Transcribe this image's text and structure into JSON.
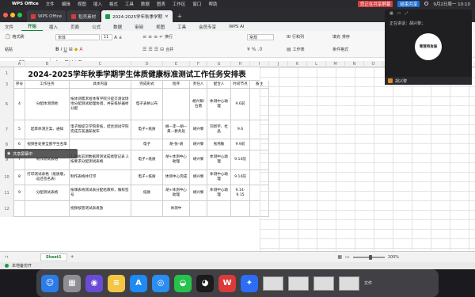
{
  "menubar": {
    "app": "WPS Office",
    "items": [
      "文件",
      "编辑",
      "视图",
      "插入",
      "格式",
      "工具",
      "数据",
      "图表",
      "工作区",
      "窗口",
      "帮助"
    ],
    "meeting_label": "您正在共享屏幕",
    "end_label": "结束共享",
    "datetime": "9月2日周一 10:10"
  },
  "tabs": [
    {
      "label": "WPS Office",
      "color": "#d93a3a"
    },
    {
      "label": "稻壳素材",
      "color": "#d93a3a"
    },
    {
      "label": "2024-2025学年秋季学期",
      "color": "#1a9e4a"
    }
  ],
  "ribbon_tabs": [
    "开始",
    "插入",
    "页面",
    "公式",
    "数据",
    "审阅",
    "视图",
    "工具",
    "会员专享",
    "WPS AI"
  ],
  "file_menu": "文件",
  "toolbar": {
    "font_name": "宋体",
    "font_size": "11",
    "number_format": "常规",
    "format_painter": "格式刷",
    "paste": "粘贴",
    "wrap": "换行",
    "merge": "合并",
    "row_col": "行和列",
    "worksheet": "工作表",
    "cond_format": "条件格式",
    "fill": "填充",
    "sort": "排序"
  },
  "formula_bar": {
    "cell_ref": "B3",
    "fx": "fx",
    "content": "器材申报"
  },
  "sheet": {
    "title": "2024-2025学年秋季学期学生体质健康标准测试工作任务安排表",
    "col_letters": [
      "A",
      "B",
      "C",
      "D",
      "E",
      "F",
      "G",
      "H",
      "I",
      "J",
      "K",
      "L",
      "M",
      "N",
      "O",
      "P",
      "Q",
      "R",
      "S",
      "T",
      "U"
    ],
    "header_row": [
      "序号",
      "工作任务",
      "具体内容",
      "完成形式",
      "程序",
      "责任人",
      "配合人",
      "时间节点",
      "备注"
    ],
    "rows": [
      {
        "num": "6",
        "no": "4",
        "task": "分配体测场地",
        "content": "按体测需求给体育学院只提交测试场地分配测试助理协调，并安排好器材分配",
        "form": "电子表格公布",
        "proc": "",
        "owner": "胡兴黎/石盾",
        "assist": "体测中心助理",
        "date": "9.6前",
        "note": ""
      },
      {
        "num": "7",
        "no": "5",
        "task": "起草体测方案、通知",
        "content": "电子版提交学院审核，结合测试学院完成方案通知发布",
        "form": "电子+纸质",
        "proc": "胡—李—胡—黄—教务处",
        "owner": "胡兴黎",
        "assist": "刘新宇、杜晶",
        "date": "9.6",
        "note": ""
      },
      {
        "num": "8",
        "no": "6",
        "task": "视频各处要全部学生名单",
        "content": "",
        "form": "电子",
        "proc": "胡-张-胡",
        "owner": "胡兴黎",
        "assist": "张燕敏",
        "date": "9.9前",
        "note": ""
      },
      {
        "num": "9",
        "no": "7",
        "task": "制作测试表格",
        "content": "1.模板前测数据转测试成绩登记表 2.按要求分配测试表格",
        "form": "电子+纸质",
        "proc": "胡+体测中心助理",
        "owner": "胡兴黎",
        "assist": "体测中心助理",
        "date": "9.14前",
        "note": ""
      },
      {
        "num": "10",
        "no": "8",
        "task": "打印测试表格（纸质版，返还签名表）",
        "content": "制作表格并打印",
        "form": "电子+纸质",
        "proc": "体测中心完成",
        "owner": "胡兴黎",
        "assist": "体测中心助理",
        "date": "9.14前",
        "note": ""
      },
      {
        "num": "11",
        "no": "9",
        "task": "分配测试表格",
        "content": "按课表将测试表分配给教师，做标签号",
        "form": "纸质",
        "proc": "胡+体测中心助理",
        "owner": "胡兴黎",
        "assist": "体测中心助理",
        "date": "9.14-9.15",
        "note": ""
      },
      {
        "num": "12",
        "no": "",
        "task": "",
        "content": "视频核管测试表发放",
        "form": "",
        "proc": "体测中",
        "owner": "",
        "assist": "",
        "date": "",
        "note": ""
      }
    ],
    "row_numbers": [
      "1",
      "2",
      "3",
      "6",
      "7",
      "8",
      "9",
      "10",
      "11",
      "12"
    ]
  },
  "floating_bar": {
    "label": "共享屏幕中"
  },
  "statusbar": {
    "sheet_tab": "Sheet1",
    "autosave": "本地备份开",
    "zoom": "100%"
  },
  "overlay": {
    "speaking": "正在讲话：胡兴黎；",
    "logo_text": "青葱特攻局",
    "user": "胡兴黎"
  },
  "dock": {
    "apps": [
      {
        "name": "finder",
        "color": "#2b7ce9",
        "glyph": "☺"
      },
      {
        "name": "launchpad",
        "color": "#8e8e93",
        "glyph": "▦"
      },
      {
        "name": "siri",
        "color": "#6a4bd6",
        "glyph": "◉"
      },
      {
        "name": "notes",
        "color": "#f4c542",
        "glyph": "≡"
      },
      {
        "name": "appstore",
        "color": "#1e8af3",
        "glyph": "A"
      },
      {
        "name": "safari",
        "color": "#2a8df0",
        "glyph": "◎"
      },
      {
        "name": "wechat",
        "color": "#27c24c",
        "glyph": "◒"
      },
      {
        "name": "qq",
        "color": "#1b1b1b",
        "glyph": "◕"
      },
      {
        "name": "wps",
        "color": "#d93a3a",
        "glyph": "W"
      },
      {
        "name": "lark",
        "color": "#2d6cf6",
        "glyph": "✦"
      }
    ],
    "thumb_label": "文件"
  }
}
